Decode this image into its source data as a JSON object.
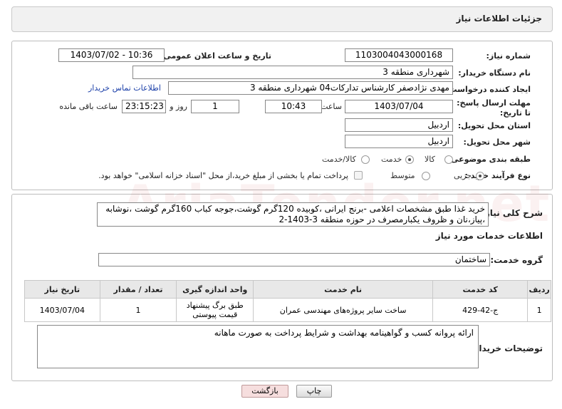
{
  "header": {
    "title": "جزئیات اطلاعات نیاز"
  },
  "form": {
    "need_number": {
      "label": "شماره نیاز:",
      "value": "1103004043000168"
    },
    "announce_datetime": {
      "label": "تاریخ و ساعت اعلان عمومی:",
      "value": "1403/07/02 - 10:36"
    },
    "buyer_org": {
      "label": "نام دستگاه خریدار:",
      "value": "شهرداری منطقه 3"
    },
    "requester": {
      "label": "ایجاد کننده درخواست:",
      "value": "مهدی نژادصفر کارشناس تدارکات04 شهرداری منطقه 3",
      "contact_link": "اطلاعات تماس خریدار"
    },
    "deadline": {
      "label": "مهلت ارسال پاسخ: تا تاریخ:",
      "date": "1403/07/04",
      "time_label": "ساعت",
      "time": "10:43",
      "days": "1",
      "days_label": "روز و",
      "remaining": "23:15:23",
      "remaining_label": "ساعت باقی مانده"
    },
    "province": {
      "label": "استان محل تحویل:",
      "value": "اردبیل"
    },
    "city": {
      "label": "شهر محل تحویل:",
      "value": "اردبیل"
    },
    "category": {
      "label": "طبقه بندی موضوعی:",
      "options": [
        "کالا",
        "خدمت",
        "کالا/خدمت"
      ],
      "selected": "خدمت"
    },
    "process": {
      "label": "نوع فرآیند خرید :",
      "options": [
        "جزیی",
        "متوسط"
      ],
      "selected": "جزیی",
      "payment_note": "پرداخت تمام یا بخشی از مبلغ خرید،از محل \"اسناد خزانه اسلامی\" خواهد بود."
    }
  },
  "summary": {
    "label": "شرح کلی نیاز:",
    "text": "خرید غذا طبق مشخصات اعلامی -برنج ایرانی ،کوبیده 120گرم گوشت،جوجه کباب 160گرم گوشت ،نوشابه ،پیاز،نان و ظروف یکبارمصرف در حوزه منطقه 3-1403-2"
  },
  "services": {
    "section_title": "اطلاعات خدمات مورد نیاز",
    "group_label": "گروه خدمت:",
    "group_value": "ساختمان",
    "columns": [
      "ردیف",
      "کد خدمت",
      "نام خدمت",
      "واحد اندازه گیری",
      "تعداد / مقدار",
      "تاریخ نیاز"
    ],
    "rows": [
      {
        "index": "1",
        "code": "ج-42-429",
        "name": "ساخت سایر پروژه‌های مهندسی عمران",
        "unit": "طبق برگ پیشنهاد قیمت پیوستی",
        "qty": "1",
        "date": "1403/07/04"
      }
    ]
  },
  "buyer_notes": {
    "label": "توضیحات خریدار:",
    "text": "ارائه پروانه کسب و گواهینامه بهداشت و شرایط پرداخت به صورت ماهانه"
  },
  "buttons": {
    "print": "چاپ",
    "back": "بازگشت"
  },
  "watermark": "AriaTender.net",
  "colors": {
    "link": "#1b3fa8",
    "back_button_bg": "#f6dede"
  }
}
